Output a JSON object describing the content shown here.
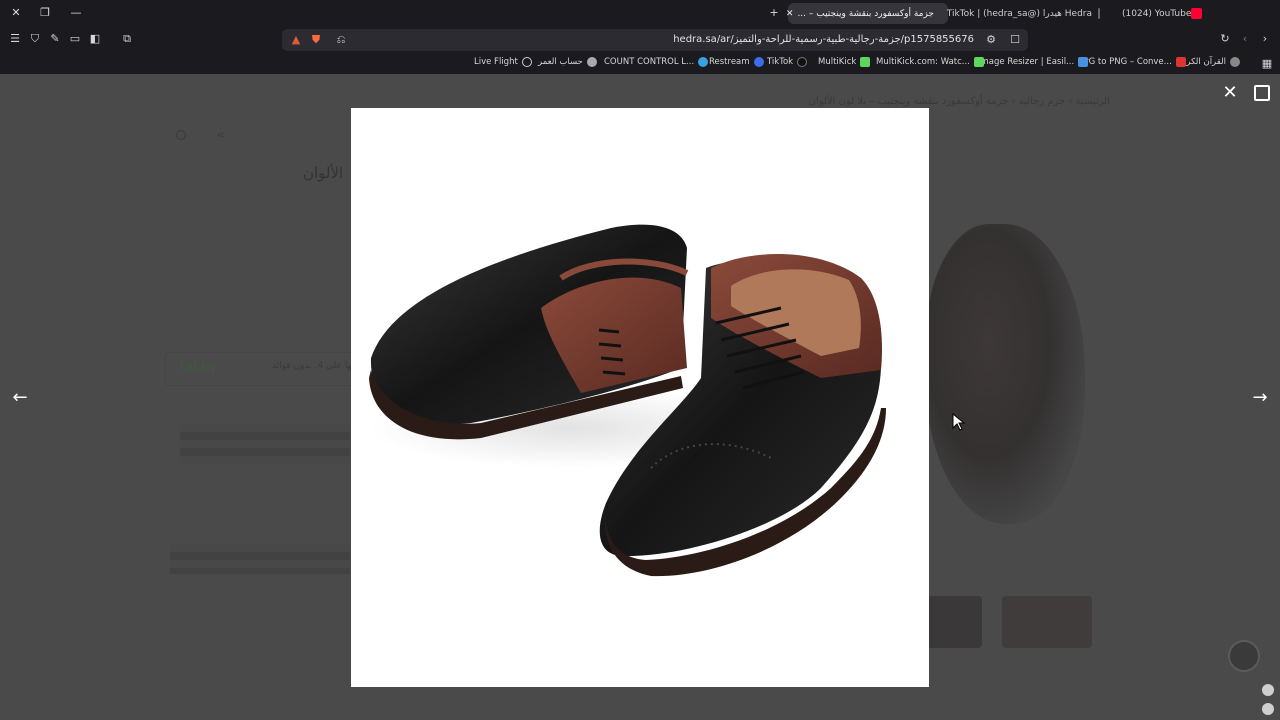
{
  "tabs": [
    {
      "label": "(1024) YouTube",
      "fav_color": "#ff0033"
    },
    {
      "label": "Hedra هيدرا (@hedra_sa) | TikTok",
      "fav_color": "#111111"
    },
    {
      "label": "جزمة أوكسفورد بنقشة وينجتيب – ...",
      "fav_color": "#cccccc"
    }
  ],
  "url": "hedra.sa/ar/جزمة-رجالية-طبية-رسمية-للراحة-والتميز/p1575855676",
  "bookmarks": [
    {
      "label": "القرآن الكريم"
    },
    {
      "label": "JPG to PNG – Conve..."
    },
    {
      "label": "Image Resizer | Easil..."
    },
    {
      "label": "MultiKick.com: Watc..."
    },
    {
      "label": "MultiKick"
    },
    {
      "label": "TikTok"
    },
    {
      "label": "Restream"
    },
    {
      "label": "COUNT CONTROL L..."
    },
    {
      "label": "حساب العمر"
    },
    {
      "label": "Live Flight"
    }
  ],
  "ghost": {
    "breadcrumb": "الرئيسية  ›  جزم رجالية  ›  جزمة أوكسفورد بنقشة وينجتيب – بلا لون الألوان",
    "title": "الألوان",
    "tabby": "tabby",
    "install": "قسّمها على 4. بدون فوائد"
  },
  "colors": {
    "accent": "#cc2b2b",
    "overlay": "#4a4a4a"
  }
}
